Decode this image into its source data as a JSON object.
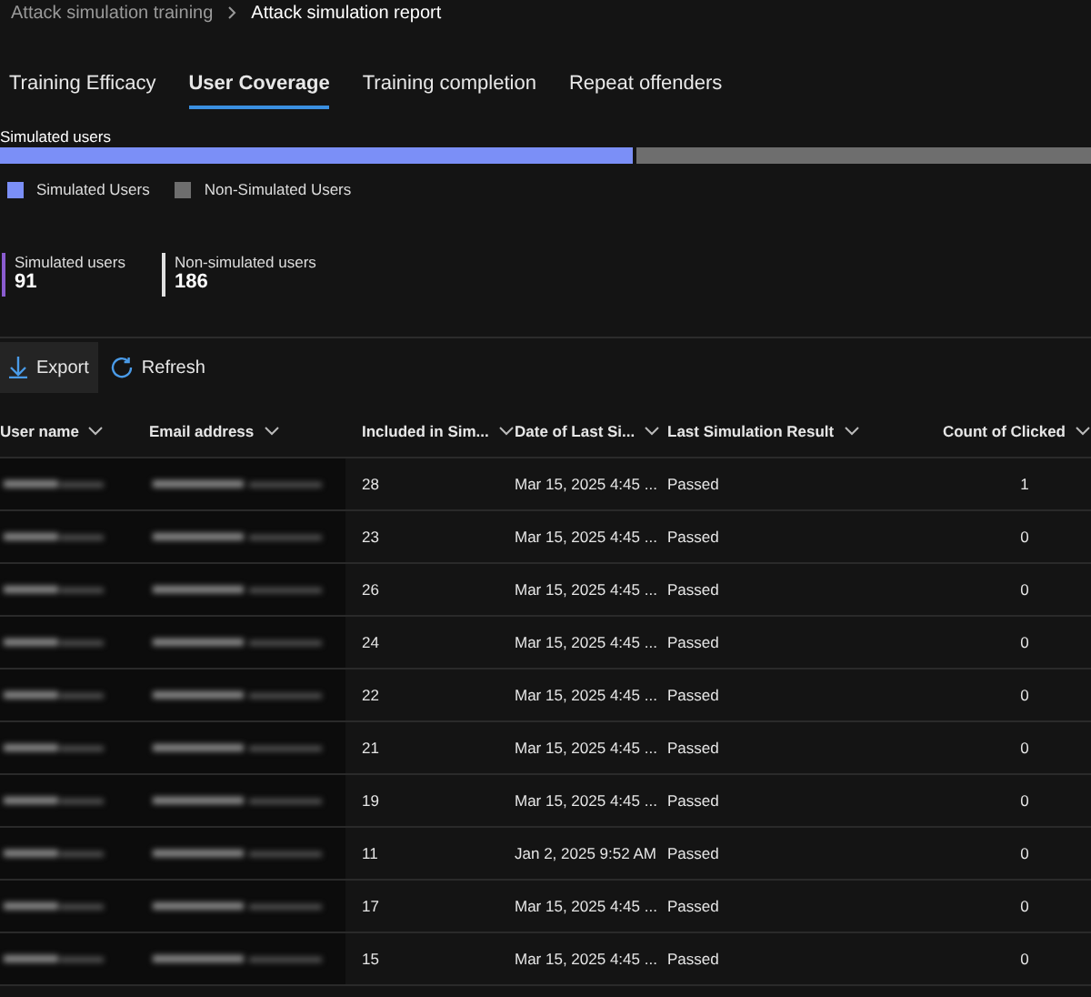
{
  "breadcrumb": [
    {
      "label": "Attack simulation training"
    },
    {
      "label": "Attack simulation report"
    }
  ],
  "tabs": [
    {
      "label": "Training Efficacy",
      "selected": false
    },
    {
      "label": "User Coverage",
      "selected": true
    },
    {
      "label": "Training completion",
      "selected": false
    },
    {
      "label": "Repeat offenders",
      "selected": false
    }
  ],
  "coverage": {
    "title": "Simulated users",
    "level": 0.58,
    "legend": [
      {
        "label": "Simulated Users",
        "color": "#7b8ff7"
      },
      {
        "label": "Non-Simulated Users",
        "color": "#6e6e6e"
      }
    ]
  },
  "stats": [
    {
      "label": "Simulated users",
      "value": "91",
      "color": "#8a5cd0"
    },
    {
      "label": "Non-simulated users",
      "value": "186",
      "color": "#e0e0e0"
    }
  ],
  "toolbar": [
    {
      "label": "Export",
      "kind": "export"
    },
    {
      "label": "Refresh",
      "kind": "refresh"
    }
  ],
  "table": {
    "columns": [
      "User name",
      "Email address",
      "Included in Sim...",
      "Date of Last Si...",
      "Last Simulation Result",
      "Count of Clicked"
    ],
    "rows": [
      [
        "",
        "",
        "28",
        "Mar 15, 2025 4:45 ...",
        "Passed",
        "1"
      ],
      [
        "",
        "",
        "23",
        "Mar 15, 2025 4:45 ...",
        "Passed",
        "0"
      ],
      [
        "",
        "",
        "26",
        "Mar 15, 2025 4:45 ...",
        "Passed",
        "0"
      ],
      [
        "",
        "",
        "24",
        "Mar 15, 2025 4:45 ...",
        "Passed",
        "0"
      ],
      [
        "",
        "",
        "22",
        "Mar 15, 2025 4:45 ...",
        "Passed",
        "0"
      ],
      [
        "",
        "",
        "21",
        "Mar 15, 2025 4:45 ...",
        "Passed",
        "0"
      ],
      [
        "",
        "",
        "19",
        "Mar 15, 2025 4:45 ...",
        "Passed",
        "0"
      ],
      [
        "",
        "",
        "11",
        "Jan 2, 2025 9:52 AM",
        "Passed",
        "0"
      ],
      [
        "",
        "",
        "17",
        "Mar 15, 2025 4:45 ...",
        "Passed",
        "0"
      ],
      [
        "",
        "",
        "15",
        "Mar 15, 2025 4:45 ...",
        "Passed",
        "0"
      ]
    ]
  }
}
